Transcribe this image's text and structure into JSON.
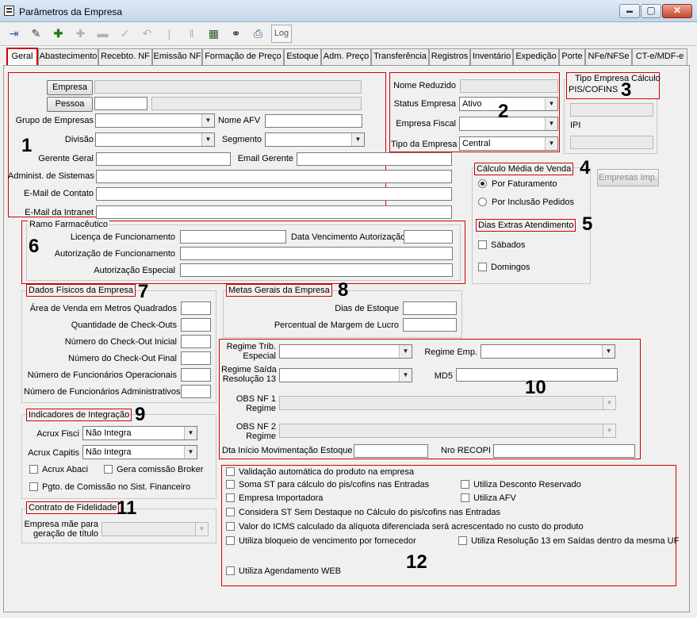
{
  "window": {
    "title": "Parâmetros da Empresa",
    "minimize": "▬",
    "maximize": "▢",
    "close": "✕"
  },
  "toolbar": {
    "log_label": "Log"
  },
  "tabs": [
    "Geral",
    "Abastecimento",
    "Recebto. NF",
    "Emissão NF",
    "Formação de Preço",
    "Estoque",
    "Adm. Preço",
    "Transferência",
    "Registros",
    "Inventário",
    "Expedição",
    "Porte",
    "NFe/NFSe",
    "CT-e/MDF-e"
  ],
  "annotations": {
    "n1": "1",
    "n2": "2",
    "n3": "3",
    "n4": "4",
    "n5": "5",
    "n6": "6",
    "n7": "7",
    "n8": "8",
    "n9": "9",
    "n10": "10",
    "n11": "11",
    "n12": "12"
  },
  "sec1": {
    "empresa_btn": "Empresa",
    "pessoa_btn": "Pessoa",
    "grupo_label": "Grupo de Empresas",
    "nome_afv_label": "Nome AFV",
    "divisao_label": "Divisão",
    "segmento_label": "Segmento",
    "gerente_label": "Gerente Geral",
    "email_gerente_label": "Email Gerente",
    "admin_label": "Administ. de Sistemas",
    "email_contato_label": "E-Mail de Contato",
    "email_intranet_label": "E-Mail da Intranet"
  },
  "sec2": {
    "nome_reduzido_label": "Nome Reduzido",
    "status_label": "Status Empresa",
    "status_value": "Ativo",
    "fiscal_label": "Empresa Fiscal",
    "tipo_label": "Tipo da Empresa",
    "tipo_value": "Central"
  },
  "sec3": {
    "title_line1": "Tipo Empresa Cálculo",
    "title_line2": "PIS/COFINS",
    "ipi_label": "IPI"
  },
  "sec4": {
    "title": "Cálculo Média de Venda",
    "opt1": "Por Faturamento",
    "opt2": "Por Inclusão Pedidos",
    "empresas_imp_btn": "Empresas Imp."
  },
  "sec5": {
    "title": "Dias Extras Atendimento",
    "sabados": "Sábados",
    "domingos": "Domingos"
  },
  "sec6": {
    "title": "Ramo Farmacêutico",
    "licenca_label": "Licença de Funcionamento",
    "data_venc_label": "Data Vencimento Autorização",
    "autorizacao_label": "Autorização de Funcionamento",
    "autorizacao_esp_label": "Autorização Especial"
  },
  "sec7": {
    "title": "Dados Físicos da Empresa",
    "area_label": "Área de Venda em Metros Quadrados",
    "qtd_checkouts_label": "Quantidade de Check-Outs",
    "checkout_ini_label": "Número do Check-Out Inicial",
    "checkout_fim_label": "Número do Check-Out Final",
    "func_oper_label": "Número de Funcionários Operacionais",
    "func_adm_label": "Número de Funcionários Administrativos"
  },
  "sec8": {
    "title": "Metas Gerais da Empresa",
    "dias_estoque_label": "Dias de Estoque",
    "margem_label": "Percentual de Margem de Lucro"
  },
  "sec9": {
    "title": "Indicadores de Integração",
    "fisci_label": "Acrux Fisci",
    "fisci_value": "Não Integra",
    "capitis_label": "Acrux Capitis",
    "capitis_value": "Não Integra",
    "abaci": "Acrux Abaci",
    "gera_comissao": "Gera comissão Broker",
    "pgto_comissao": "Pgto. de Comissão no Sist. Financeiro"
  },
  "sec10": {
    "regime_trib_l1": "Regime Trib.",
    "regime_trib_l2": "Especial",
    "regime_emp_label": "Regime Emp.",
    "regime_saida_l1": "Regime Saída",
    "regime_saida_l2": "Resolução 13",
    "md5_label": "MD5",
    "obs1_l1": "OBS NF 1",
    "obs1_l2": "Regime",
    "obs2_l1": "OBS NF 2",
    "obs2_l2": "Regime",
    "dta_inicio_label": "Dta Início Movimentação Estoque",
    "recopi_label": "Nro RECOPI"
  },
  "sec11": {
    "title": "Contrato de Fidelidade",
    "empresa_mae_l1": "Empresa mãe para",
    "empresa_mae_l2": "geração de título"
  },
  "sec12": {
    "validacao": "Validação automática do produto na empresa",
    "soma_st": "Soma ST para cálculo do pis/cofins nas Entradas",
    "desconto": "Utiliza Desconto Reservado",
    "importadora": "Empresa Importadora",
    "afv": "Utiliza AFV",
    "considera_st": "Considera ST Sem Destaque no Cálculo do pis/cofins nas Entradas",
    "valor_icms": "Valor do ICMS calculado da alíquota diferenciada será acrescentado no custo do produto",
    "bloqueio": "Utiliza bloqueio de vencimento por fornecedor",
    "resolucao13": "Utiliza Resolução 13 em Saídas dentro da mesma UF",
    "agendamento": "Utiliza Agendamento WEB"
  }
}
